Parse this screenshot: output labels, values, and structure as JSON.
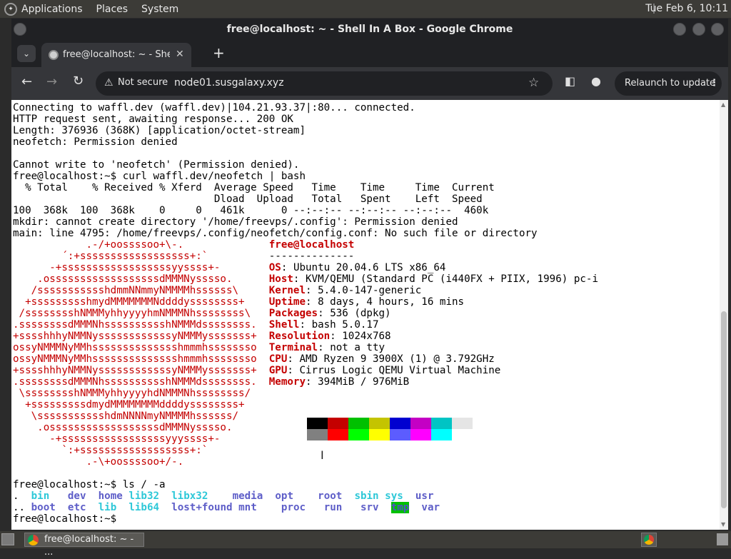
{
  "panel": {
    "menus": [
      "Applications",
      "Places",
      "System"
    ],
    "clock": "Tue Feb  6, 10:11"
  },
  "window": {
    "title": "free@localhost: ~ - Shell In A Box - Google Chrome"
  },
  "tab": {
    "title": "free@localhost: ~ - Shell In A Box"
  },
  "toolbar": {
    "security_label": "Not secure",
    "url": "node01.susgalaxy.xyz",
    "relaunch_label": "Relaunch to update"
  },
  "terminal": {
    "lines": [
      "Connecting to waffl.dev (waffl.dev)|104.21.93.37|:80... connected.",
      "HTTP request sent, awaiting response... 200 OK",
      "Length: 376936 (368K) [application/octet-stream]",
      "neofetch: Permission denied",
      "",
      "Cannot write to 'neofetch' (Permission denied).",
      "free@localhost:~$ curl waffl.dev/neofetch | bash",
      "  % Total    % Received % Xferd  Average Speed   Time    Time     Time  Current",
      "                                 Dload  Upload   Total   Spent    Left  Speed",
      "100  368k  100  368k    0     0   461k      0 --:--:-- --:--:-- --:--:--  460k",
      "mkdir: cannot create directory '/home/freevps/.config': Permission denied",
      "main: line 4795: /home/freevps/.config/neofetch/config.conf: No such file or directory"
    ],
    "logo": [
      "            .-/+oossssoo+\\-.",
      "        ´:+ssssssssssssssssss+:`",
      "      -+ssssssssssssssssssyyssss+-",
      "    .ossssssssssssssssssdMMMNysssso.",
      "   /ssssssssssshdmmNNmmyNMMMMhssssss\\",
      "  +ssssssssshmydMMMMMMMNddddyssssssss+",
      " /sssssssshNMMMyhhyyyyhmNMMMNhssssssss\\",
      ".ssssssssdMMMNhsssssssssshNMMMdssssssss.",
      "+sssshhhyNMMNyssssssssssssyNMMMysssssss+",
      "ossyNMMMNyMMhsssssssssssssshmmmhssssssso",
      "ossyNMMMNyMMhsssssssssssssshmmmhssssssso",
      "+sssshhhyNMMNyssssssssssssyNMMMysssssss+",
      ".ssssssssdMMMNhsssssssssshNMMMdssssssss.",
      " \\sssssssshNMMMyhhyyyyhdNMMMNhssssssss/",
      "  +sssssssssdmydMMMMMMMMddddyssssssss+",
      "   \\ssssssssssshdmNNNNmyNMMMMhssssss/",
      "    .ossssssssssssssssssdMMMNysssso.",
      "      -+sssssssssssssssssyyyssss+-",
      "        `:+ssssssssssssssssss+:`",
      "            .-\\+oossssoo+/-."
    ],
    "info_title": "free@localhost",
    "info_rule": "--------------",
    "info": [
      {
        "key": "OS",
        "value": "Ubuntu 20.04.6 LTS x86_64"
      },
      {
        "key": "Host",
        "value": "KVM/QEMU (Standard PC (i440FX + PIIX, 1996) pc-i"
      },
      {
        "key": "Kernel",
        "value": "5.4.0-147-generic"
      },
      {
        "key": "Uptime",
        "value": "8 days, 4 hours, 16 mins"
      },
      {
        "key": "Packages",
        "value": "536 (dpkg)"
      },
      {
        "key": "Shell",
        "value": "bash 5.0.17"
      },
      {
        "key": "Resolution",
        "value": "1024x768"
      },
      {
        "key": "Terminal",
        "value": "not a tty"
      },
      {
        "key": "CPU",
        "value": "AMD Ryzen 9 3900X (1) @ 3.792GHz"
      },
      {
        "key": "GPU",
        "value": "Cirrus Logic QEMU Virtual Machine"
      },
      {
        "key": "Memory",
        "value": "394MiB / 976MiB"
      }
    ],
    "palette_top": [
      "#000000",
      "#c40000",
      "#00c000",
      "#c4c400",
      "#0000d0",
      "#c400c4",
      "#00c4c4",
      "#e5e5e5"
    ],
    "palette_bottom": [
      "#808080",
      "#ff0000",
      "#00ff00",
      "#ffff00",
      "#5c5cff",
      "#ff00ff",
      "#00ffff",
      "#ffffff"
    ],
    "ls_command": "free@localhost:~$ ls / -a",
    "ls_row1": [
      ".",
      "bin",
      "dev",
      "home",
      "lib32",
      "libx32",
      "media",
      "opt",
      "root",
      "sbin",
      "sys",
      "usr"
    ],
    "ls_row2": [
      "..",
      "boot",
      "etc",
      "lib",
      "lib64",
      "lost+found",
      "mnt",
      "proc",
      "run",
      "srv",
      "tmp",
      "var"
    ],
    "prompt": "free@localhost:~$"
  },
  "taskbar": {
    "task_title": "free@localhost: ~ - ..."
  }
}
